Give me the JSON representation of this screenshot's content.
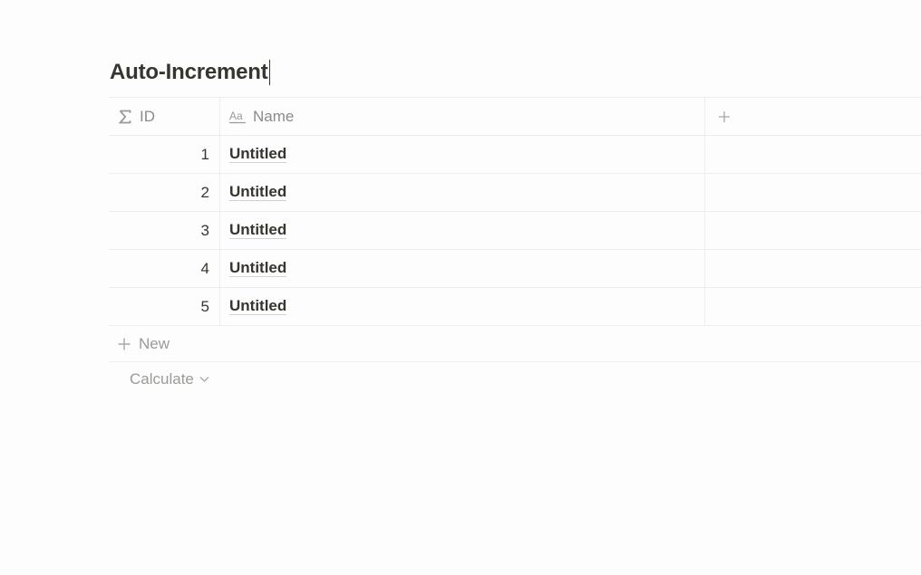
{
  "title": "Auto-Increment",
  "columns": {
    "id": {
      "label": "ID",
      "icon": "sigma-icon"
    },
    "name": {
      "label": "Name",
      "icon": "text-aa-icon"
    },
    "add": {
      "icon": "plus-icon"
    }
  },
  "rows": [
    {
      "id": "1",
      "name": "Untitled"
    },
    {
      "id": "2",
      "name": "Untitled"
    },
    {
      "id": "3",
      "name": "Untitled"
    },
    {
      "id": "4",
      "name": "Untitled"
    },
    {
      "id": "5",
      "name": "Untitled"
    }
  ],
  "footer": {
    "new_label": "New",
    "calculate_label": "Calculate"
  },
  "colors": {
    "text": "#37352f",
    "muted": "#9b9a97",
    "border": "#ededec",
    "background": "#fdfdfd"
  }
}
